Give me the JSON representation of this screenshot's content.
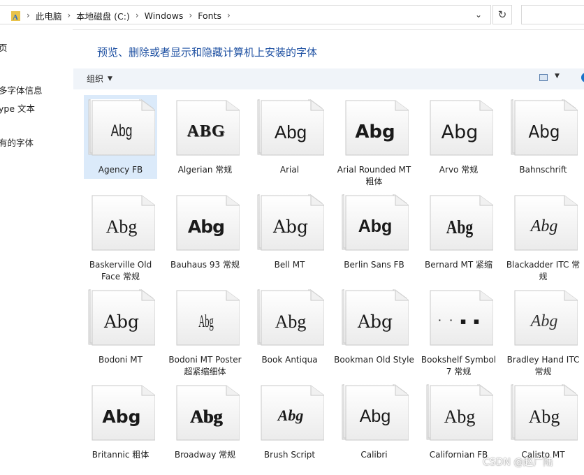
{
  "address": {
    "breadcrumbs": [
      "此电脑",
      "本地磁盘 (C:)",
      "Windows",
      "Fonts"
    ]
  },
  "left_pane": {
    "links": [
      "页",
      "多字体信息",
      "ype 文本",
      "有的字体"
    ]
  },
  "main": {
    "title": "预览、删除或者显示和隐藏计算机上安装的字体",
    "organize_label": "组织"
  },
  "fonts": [
    {
      "name": "Agency FB",
      "sample": "Abg",
      "stacked": true,
      "selected": true
    },
    {
      "name": "Algerian 常规",
      "sample": "ABG",
      "stacked": false
    },
    {
      "name": "Arial",
      "sample": "Abg",
      "stacked": true
    },
    {
      "name": "Arial Rounded MT 粗体",
      "sample": "Abg",
      "stacked": false
    },
    {
      "name": "Arvo 常规",
      "sample": "Abg",
      "stacked": false
    },
    {
      "name": "Bahnschrift",
      "sample": "Abg",
      "stacked": true
    },
    {
      "name": "Baskerville Old Face 常规",
      "sample": "Abg",
      "stacked": false
    },
    {
      "name": "Bauhaus 93 常规",
      "sample": "Abg",
      "stacked": false
    },
    {
      "name": "Bell MT",
      "sample": "Abg",
      "stacked": true
    },
    {
      "name": "Berlin Sans FB",
      "sample": "Abg",
      "stacked": true
    },
    {
      "name": "Bernard MT 紧缩",
      "sample": "Abg",
      "stacked": false
    },
    {
      "name": "Blackadder ITC 常规",
      "sample": "Abg",
      "stacked": false
    },
    {
      "name": "Bodoni MT",
      "sample": "Abg",
      "stacked": true
    },
    {
      "name": "Bodoni MT Poster 超紧缩细体",
      "sample": "Abg",
      "stacked": false
    },
    {
      "name": "Book Antiqua",
      "sample": "Abg",
      "stacked": true
    },
    {
      "name": "Bookman Old Style",
      "sample": "Abg",
      "stacked": true
    },
    {
      "name": "Bookshelf Symbol 7 常规",
      "sample": "⠂⠐ ▪ ▪",
      "stacked": false
    },
    {
      "name": "Bradley Hand ITC 常规",
      "sample": "Abg",
      "stacked": false
    },
    {
      "name": "Britannic 粗体",
      "sample": "Abg",
      "stacked": false
    },
    {
      "name": "Broadway 常规",
      "sample": "Abg",
      "stacked": false
    },
    {
      "name": "Brush Script",
      "sample": "Abg",
      "stacked": false
    },
    {
      "name": "Calibri",
      "sample": "Abg",
      "stacked": true
    },
    {
      "name": "Californian FB",
      "sample": "Abg",
      "stacked": true
    },
    {
      "name": "Calisto MT",
      "sample": "Abg",
      "stacked": true
    }
  ],
  "watermark": "CSDN @赵广陆"
}
